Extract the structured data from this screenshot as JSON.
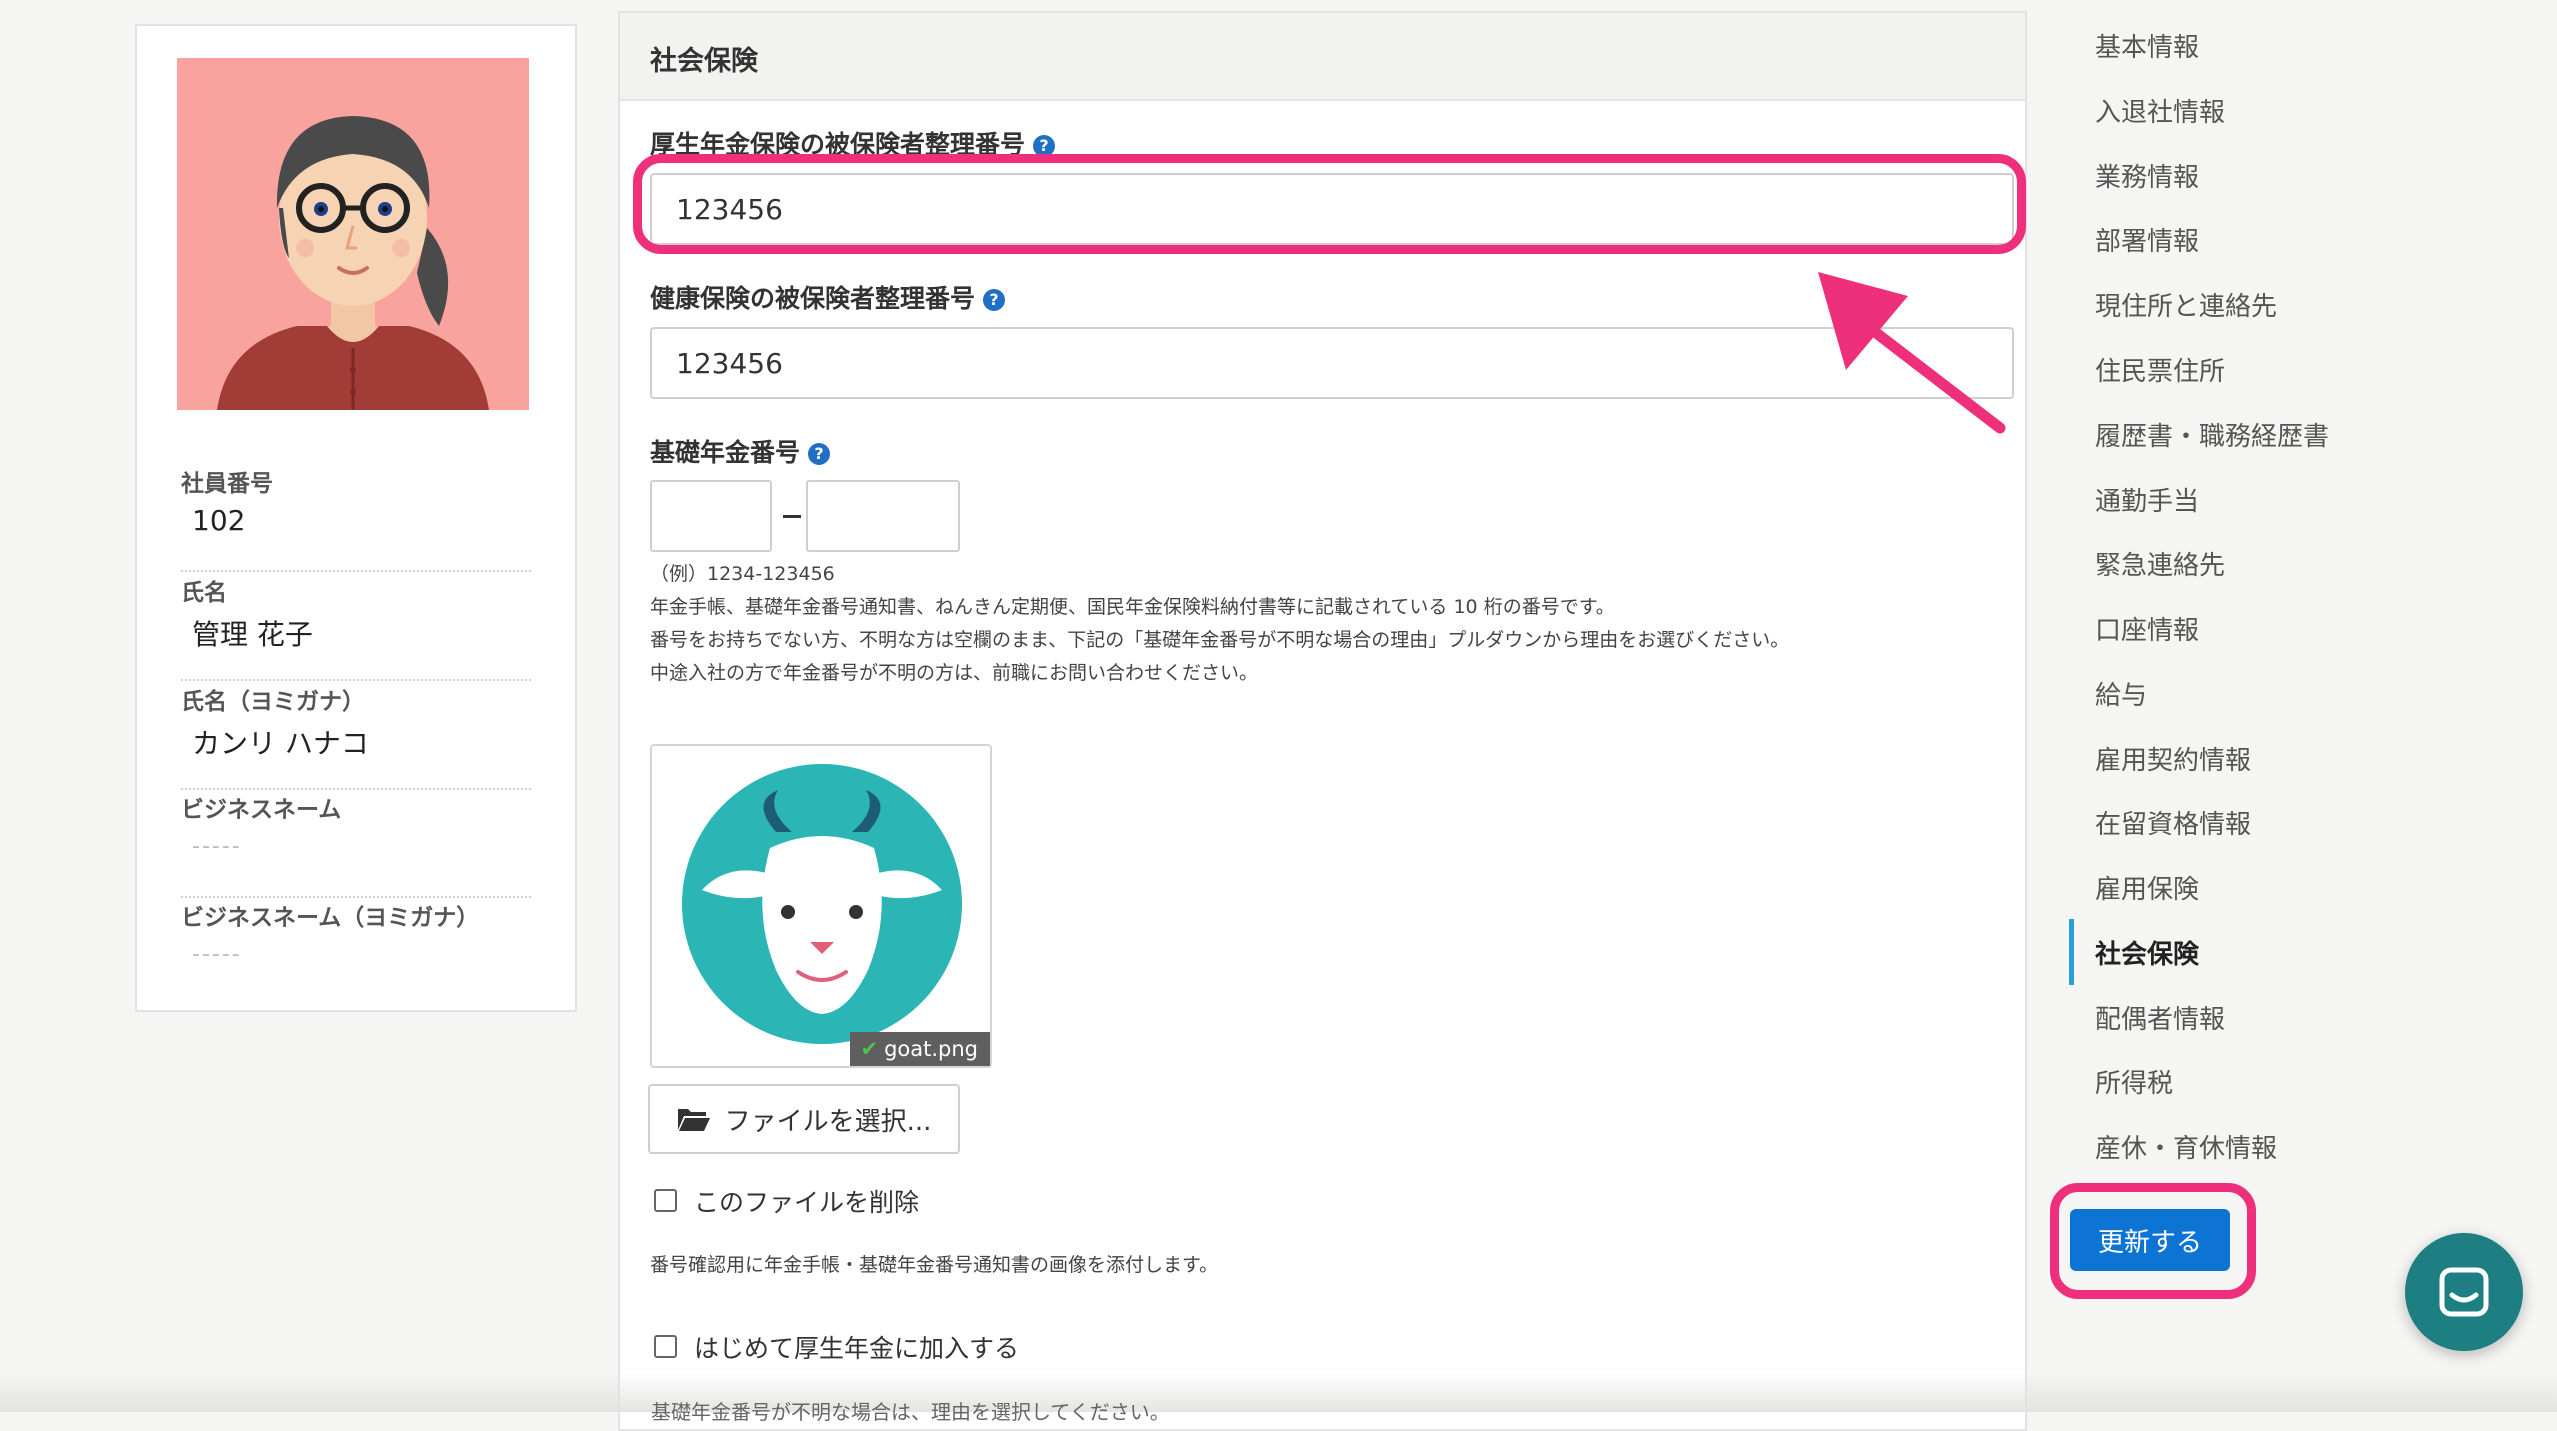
{
  "profile": {
    "fields": [
      {
        "label": "社員番号",
        "value": "102"
      },
      {
        "label": "氏名",
        "value": "管理 花子"
      },
      {
        "label": "氏名（ヨミガナ）",
        "value": "カンリ ハナコ"
      },
      {
        "label": "ビジネスネーム",
        "value": "-----"
      },
      {
        "label": "ビジネスネーム（ヨミガナ）",
        "value": "-----"
      }
    ]
  },
  "section": {
    "title": "社会保険",
    "pension_insurance": {
      "label": "厚生年金保険の被保険者整理番号",
      "value": "123456"
    },
    "health_insurance": {
      "label": "健康保険の被保険者整理番号",
      "value": "123456"
    },
    "basic_pension": {
      "label": "基礎年金番号",
      "part1": "",
      "part2": "",
      "example": "（例）1234-123456",
      "notes": [
        "年金手帳、基礎年金番号通知書、ねんきん定期便、国民年金保険料納付書等に記載されている 10 桁の番号です。",
        "番号をお持ちでない方、不明な方は空欄のまま、下記の「基礎年金番号が不明な場合の理由」プルダウンから理由をお選びください。",
        "中途入社の方で年金番号が不明の方は、前職にお問い合わせください。"
      ]
    },
    "attachment": {
      "filename": "goat.png",
      "select_button": "ファイルを選択...",
      "delete_label": "このファイルを削除",
      "hint": "番号確認用に年金手帳・基礎年金番号通知書の画像を添付します。"
    },
    "first_enroll_label": "はじめて厚生年金に加入する",
    "cut_off_text": "基礎年金番号が不明な場合は、理由を選択してください。"
  },
  "nav": {
    "items": [
      "基本情報",
      "入退社情報",
      "業務情報",
      "部署情報",
      "現住所と連絡先",
      "住民票住所",
      "履歴書・職務経歴書",
      "通勤手当",
      "緊急連絡先",
      "口座情報",
      "給与",
      "雇用契約情報",
      "在留資格情報",
      "雇用保険",
      "社会保険",
      "配偶者情報",
      "所得税",
      "産休・育休情報"
    ],
    "active": "社会保険",
    "update_button": "更新する"
  },
  "icons": {
    "help": "question-circle-icon",
    "folder": "folder-open-icon",
    "check": "check-icon",
    "chat": "chat-icon"
  },
  "colors": {
    "accent_blue": "#0d74d4",
    "highlight_pink": "#ee2f7b",
    "active_indicator": "#2a9fd6",
    "chat_teal": "#1e7f82",
    "avatar_bg": "#f9a39e",
    "goat_bg": "#2bb5b5"
  }
}
